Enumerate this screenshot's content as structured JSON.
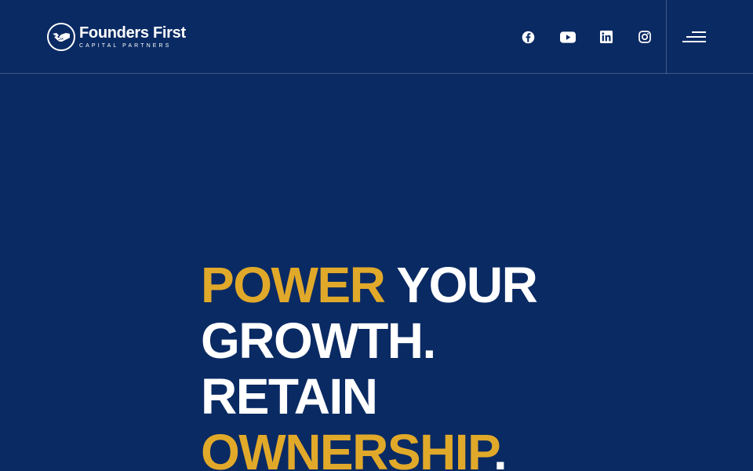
{
  "header": {
    "logo": {
      "title": "Founders First",
      "subtitle": "CAPITAL PARTNERS"
    },
    "social": [
      {
        "name": "facebook",
        "icon": "facebook-icon"
      },
      {
        "name": "youtube",
        "icon": "youtube-icon"
      },
      {
        "name": "linkedin",
        "icon": "linkedin-icon"
      },
      {
        "name": "instagram",
        "icon": "instagram-icon"
      }
    ],
    "menu_icon": "hamburger-menu-icon"
  },
  "hero": {
    "line1_accent": "POWER",
    "line1_rest": " YOUR",
    "line2": "GROWTH.",
    "line3": "RETAIN",
    "line4_accent": "OWNERSHIP",
    "line4_rest": "."
  },
  "colors": {
    "background": "#0a2a63",
    "accent": "#e1a92a",
    "text": "#ffffff"
  }
}
